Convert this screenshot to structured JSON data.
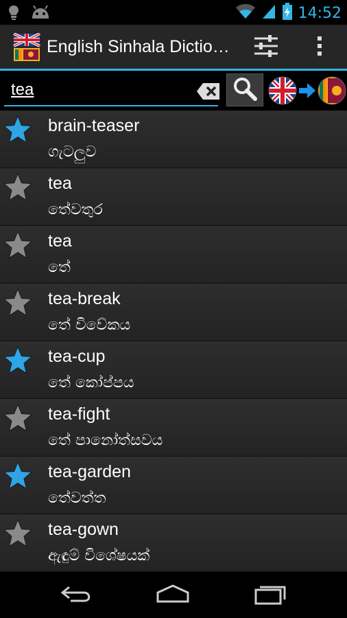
{
  "status_bar": {
    "time": "14:52",
    "icons": [
      "notification-icon",
      "android-debug-icon",
      "wifi-icon",
      "signal-icon",
      "battery-charging-icon"
    ]
  },
  "action_bar": {
    "title": "English Sinhala Dictio…",
    "app_icon": "flags-icon",
    "settings_icon": "settings-sliders-icon",
    "overflow_icon": "overflow-menu-icon"
  },
  "search": {
    "value": "tea",
    "clear_icon": "backspace-clear-icon",
    "search_icon": "magnifier-icon",
    "direction_icon": "english-to-sinhala-icon"
  },
  "accent_color": "#33b5e5",
  "results": [
    {
      "word": "brain-teaser",
      "meaning": "ගැටලුව",
      "starred": true
    },
    {
      "word": "tea",
      "meaning": "තේවතුර",
      "starred": false
    },
    {
      "word": "tea",
      "meaning": "තේ",
      "starred": false
    },
    {
      "word": "tea-break",
      "meaning": "තේ විවේකය",
      "starred": false
    },
    {
      "word": "tea-cup",
      "meaning": "තේ කෝප්පය",
      "starred": true
    },
    {
      "word": "tea-fight",
      "meaning": "තේ පානෝත්සවය",
      "starred": false
    },
    {
      "word": "tea-garden",
      "meaning": "තේවත්ත",
      "starred": true
    },
    {
      "word": "tea-gown",
      "meaning": "ඇඳුම් විශේෂයක්",
      "starred": false
    }
  ],
  "nav_bar": {
    "icons": [
      "back-icon",
      "home-icon",
      "recent-apps-icon"
    ]
  }
}
